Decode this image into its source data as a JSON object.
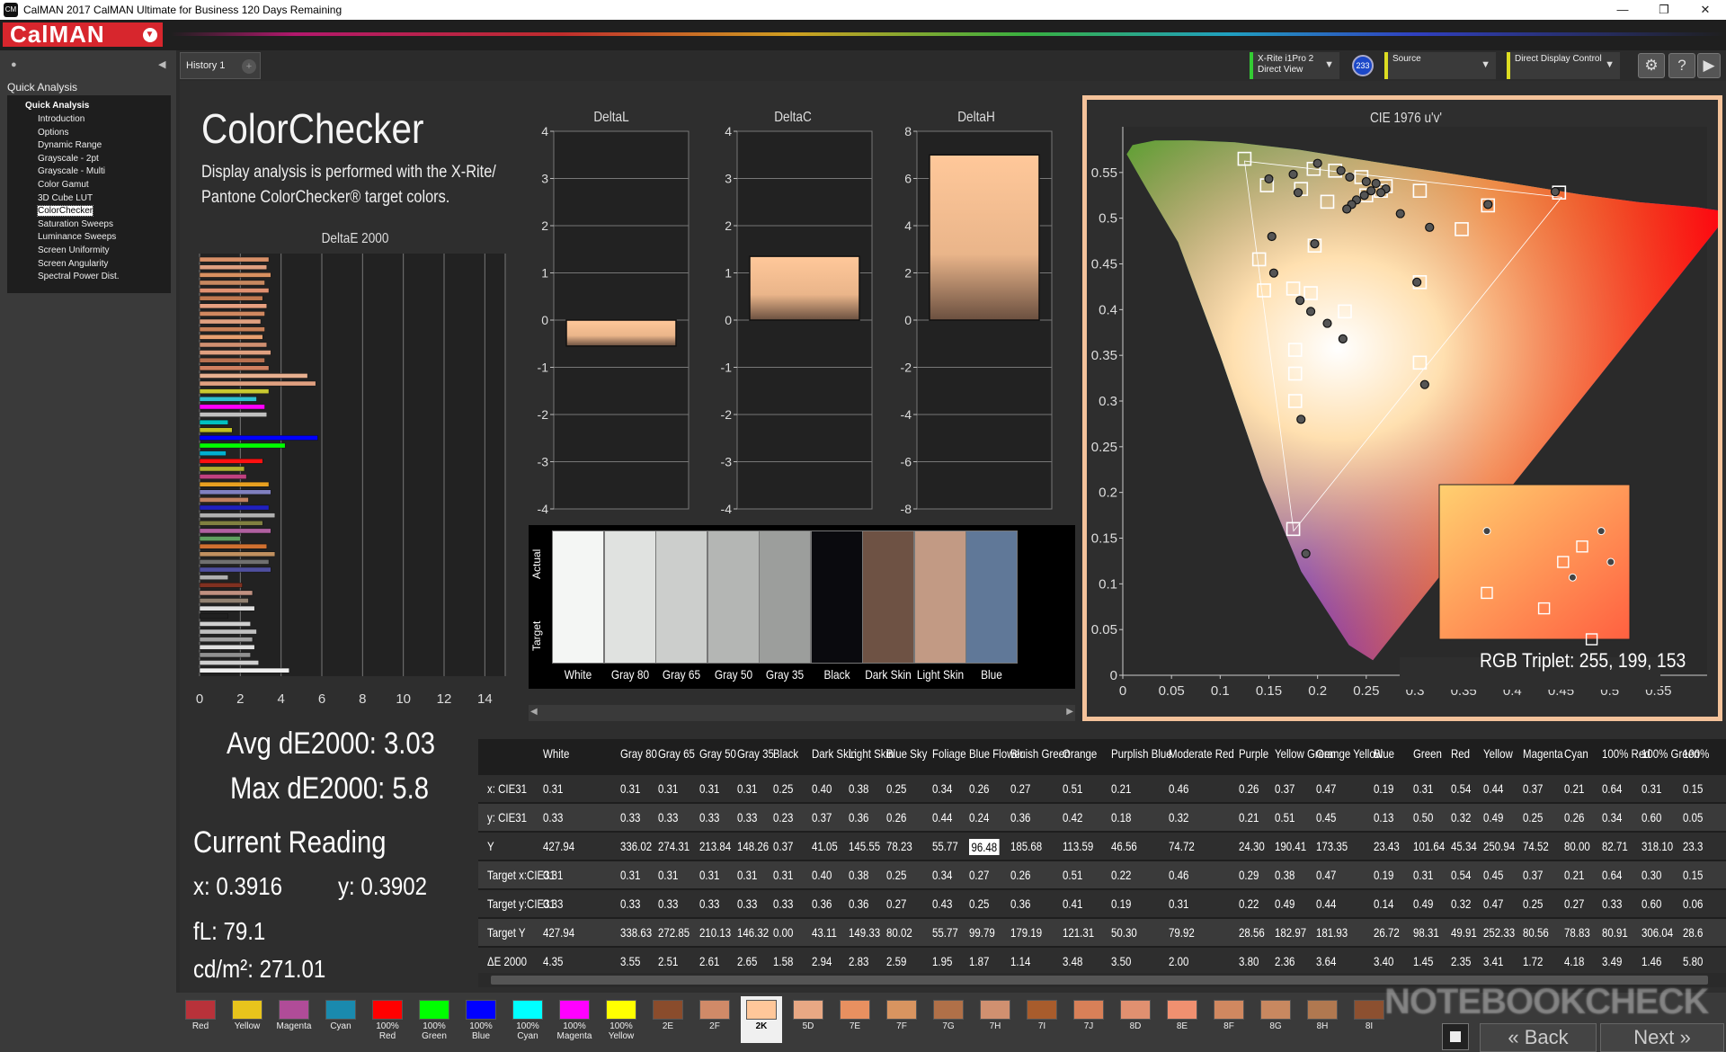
{
  "window": {
    "title": "CalMAN 2017 CalMAN Ultimate for Business 120 Days Remaining",
    "icon_text": "CM"
  },
  "brand": {
    "logo": "CalMAN"
  },
  "sidebar": {
    "heading": "Quick Analysis",
    "root": "Quick Analysis",
    "items": [
      "Introduction",
      "Options",
      "Dynamic Range",
      "Grayscale - 2pt",
      "Grayscale - Multi",
      "Color Gamut",
      "3D Cube LUT",
      "ColorChecker",
      "Saturation Sweeps",
      "Luminance Sweeps",
      "Screen Uniformity",
      "Screen Angularity",
      "Spectral Power Dist."
    ],
    "selected": "ColorChecker"
  },
  "tabs": {
    "history": "History 1"
  },
  "controls": {
    "meter_line1": "X-Rite i1Pro 2",
    "meter_line2": "Direct View",
    "meter_badge": "233",
    "source": "Source",
    "display": "Direct Display Control"
  },
  "page": {
    "title": "ColorChecker",
    "desc_line1": "Display analysis is performed with the X-Rite/",
    "desc_line2": "Pantone ColorChecker® target colors."
  },
  "charts_titles": {
    "de": "DeltaE 2000",
    "dl": "DeltaL",
    "dc": "DeltaC",
    "dh": "DeltaH",
    "cie": "CIE 1976 u'v'"
  },
  "swatch_labels": {
    "actual": "Actual",
    "target": "Target"
  },
  "swatches": [
    {
      "name": "White",
      "color": "#f4f6f4"
    },
    {
      "name": "Gray 80",
      "color": "#e0e2e0"
    },
    {
      "name": "Gray 65",
      "color": "#cccecc"
    },
    {
      "name": "Gray 50",
      "color": "#b4b6b4"
    },
    {
      "name": "Gray 35",
      "color": "#9c9e9c"
    },
    {
      "name": "Black",
      "color": "#0a0a0e"
    },
    {
      "name": "Dark Skin",
      "color": "#6e5244"
    },
    {
      "name": "Light Skin",
      "color": "#c29a84"
    },
    {
      "name": "Blue",
      "color": "#607898"
    }
  ],
  "stats": {
    "avg": "Avg dE2000: 3.03",
    "max": "Max dE2000: 5.8",
    "current_reading": "Current Reading",
    "x": "x: 0.3916",
    "y": "y: 0.3902",
    "fl": "fL: 79.1",
    "cdm2": "cd/m²: 271.01",
    "rgb_triplet": "RGB Triplet: 255, 199, 153"
  },
  "table": {
    "columns": [
      "White",
      "Gray 80",
      "Gray 65",
      "Gray 50",
      "Gray 35",
      "Black",
      "Dark Skin",
      "Light Skin",
      "Blue Sky",
      "Foliage",
      "Blue Flower",
      "Bluish Green",
      "Orange",
      "Purplish Blue",
      "Moderate Red",
      "Purple",
      "Yellow Green",
      "Orange Yellow",
      "Blue",
      "Green",
      "Red",
      "Yellow",
      "Magenta",
      "Cyan",
      "100% Red",
      "100% Green",
      "100%"
    ],
    "rows": [
      {
        "label": "x: CIE31",
        "values": [
          "0.31",
          "0.31",
          "0.31",
          "0.31",
          "0.31",
          "0.25",
          "0.40",
          "0.38",
          "0.25",
          "0.34",
          "0.26",
          "0.27",
          "0.51",
          "0.21",
          "0.46",
          "0.26",
          "0.37",
          "0.47",
          "0.19",
          "0.31",
          "0.54",
          "0.44",
          "0.37",
          "0.21",
          "0.64",
          "0.31",
          "0.15"
        ]
      },
      {
        "label": "y: CIE31",
        "values": [
          "0.33",
          "0.33",
          "0.33",
          "0.33",
          "0.33",
          "0.23",
          "0.37",
          "0.36",
          "0.26",
          "0.44",
          "0.24",
          "0.36",
          "0.42",
          "0.18",
          "0.32",
          "0.21",
          "0.51",
          "0.45",
          "0.13",
          "0.50",
          "0.32",
          "0.49",
          "0.25",
          "0.26",
          "0.34",
          "0.60",
          "0.05"
        ]
      },
      {
        "label": "Y",
        "values": [
          "427.94",
          "336.02",
          "274.31",
          "213.84",
          "148.26",
          "0.37",
          "41.05",
          "145.55",
          "78.23",
          "55.77",
          "96.48",
          "185.68",
          "113.59",
          "46.56",
          "74.72",
          "24.30",
          "190.41",
          "173.35",
          "23.43",
          "101.64",
          "45.34",
          "250.94",
          "74.52",
          "80.00",
          "82.71",
          "318.10",
          "23.3"
        ]
      },
      {
        "label": "Target x:CIE31",
        "values": [
          "0.31",
          "0.31",
          "0.31",
          "0.31",
          "0.31",
          "0.31",
          "0.40",
          "0.38",
          "0.25",
          "0.34",
          "0.27",
          "0.26",
          "0.51",
          "0.22",
          "0.46",
          "0.29",
          "0.38",
          "0.47",
          "0.19",
          "0.31",
          "0.54",
          "0.45",
          "0.37",
          "0.21",
          "0.64",
          "0.30",
          "0.15"
        ]
      },
      {
        "label": "Target y:CIE31",
        "values": [
          "0.33",
          "0.33",
          "0.33",
          "0.33",
          "0.33",
          "0.33",
          "0.36",
          "0.36",
          "0.27",
          "0.43",
          "0.25",
          "0.36",
          "0.41",
          "0.19",
          "0.31",
          "0.22",
          "0.49",
          "0.44",
          "0.14",
          "0.49",
          "0.32",
          "0.47",
          "0.25",
          "0.27",
          "0.33",
          "0.60",
          "0.06"
        ]
      },
      {
        "label": "Target Y",
        "values": [
          "427.94",
          "338.63",
          "272.85",
          "210.13",
          "146.32",
          "0.00",
          "43.11",
          "149.33",
          "80.02",
          "55.77",
          "99.79",
          "179.19",
          "121.31",
          "50.30",
          "79.92",
          "28.56",
          "182.97",
          "181.93",
          "26.72",
          "98.31",
          "49.91",
          "252.33",
          "80.56",
          "78.83",
          "80.91",
          "306.04",
          "28.6"
        ]
      },
      {
        "label": "ΔE 2000",
        "values": [
          "4.35",
          "3.55",
          "2.51",
          "2.61",
          "2.65",
          "1.58",
          "2.94",
          "2.83",
          "2.59",
          "1.95",
          "1.87",
          "1.14",
          "3.48",
          "3.50",
          "2.00",
          "3.80",
          "2.36",
          "3.64",
          "3.40",
          "1.45",
          "2.35",
          "3.41",
          "1.72",
          "4.18",
          "3.49",
          "1.46",
          "5.80"
        ]
      }
    ],
    "highlight": {
      "row": 2,
      "col": 10
    }
  },
  "patches": [
    {
      "label": "Red",
      "color": "#b8323a"
    },
    {
      "label": "Yellow",
      "color": "#e8c41c"
    },
    {
      "label": "Magenta",
      "color": "#b04c98"
    },
    {
      "label": "Cyan",
      "color": "#1a8aae"
    },
    {
      "label": "100% Red",
      "color": "#ff0000"
    },
    {
      "label": "100% Green",
      "color": "#00ff00"
    },
    {
      "label": "100% Blue",
      "color": "#0000ff"
    },
    {
      "label": "100% Cyan",
      "color": "#00ffff"
    },
    {
      "label": "100% Magenta",
      "color": "#ff00ff"
    },
    {
      "label": "100% Yellow",
      "color": "#ffff00"
    },
    {
      "label": "2E",
      "color": "#8a4c2c"
    },
    {
      "label": "2F",
      "color": "#d08a68"
    },
    {
      "label": "2K",
      "color": "#ffc79a"
    },
    {
      "label": "5D",
      "color": "#e8a884"
    },
    {
      "label": "7E",
      "color": "#e89060"
    },
    {
      "label": "7F",
      "color": "#d89460"
    },
    {
      "label": "7G",
      "color": "#b07048"
    },
    {
      "label": "7H",
      "color": "#d09070"
    },
    {
      "label": "7I",
      "color": "#a85c2c"
    },
    {
      "label": "7J",
      "color": "#d88058"
    },
    {
      "label": "8D",
      "color": "#e09070"
    },
    {
      "label": "8E",
      "color": "#f09070"
    },
    {
      "label": "8F",
      "color": "#d08860"
    },
    {
      "label": "8G",
      "color": "#c88860"
    },
    {
      "label": "8H",
      "color": "#b07850"
    },
    {
      "label": "8I",
      "color": "#8c5030"
    }
  ],
  "selected_patch": "2K",
  "nav": {
    "back": "Back",
    "next": "Next"
  },
  "watermark": "NOTEBOOKCHECK",
  "chart_data": [
    {
      "type": "bar",
      "title": "DeltaE 2000",
      "orientation": "horizontal",
      "xlim": [
        0,
        15
      ],
      "xticks": [
        "0",
        "2",
        "4",
        "6",
        "8",
        "10",
        "12",
        "14"
      ],
      "values": [
        3.4,
        3.3,
        3.5,
        3.2,
        3.4,
        3.1,
        3.3,
        3.2,
        3.0,
        3.2,
        3.1,
        3.3,
        3.5,
        3.2,
        3.4,
        5.3,
        5.7,
        3.4,
        2.8,
        3.2,
        3.3,
        1.4,
        1.6,
        5.8,
        4.2,
        1.3,
        3.1,
        2.2,
        2.3,
        3.4,
        3.5,
        2.4,
        3.4,
        3.7,
        3.1,
        3.5,
        2.0,
        3.3,
        3.7,
        3.4,
        3.5,
        1.4,
        2.1,
        2.6,
        2.4,
        2.7,
        1.4,
        2.5,
        2.8,
        2.6,
        2.7,
        2.5,
        2.9,
        4.4
      ],
      "colors": [
        "#d89068",
        "#e0a080",
        "#d89060",
        "#c88860",
        "#e09070",
        "#c07850",
        "#e8a080",
        "#d08860",
        "#e0a080",
        "#c88058",
        "#e8a070",
        "#d09070",
        "#e0a080",
        "#b87050",
        "#d08060",
        "#e8b090",
        "#e0a080",
        "#c8c830",
        "#30c0d0",
        "#ff00ff",
        "#c0c0c0",
        "#00c0c0",
        "#c0c020",
        "#0000ff",
        "#00ff00",
        "#00b0d0",
        "#ff1010",
        "#b0b030",
        "#c04080",
        "#e8a020",
        "#8080c0",
        "#c08060",
        "#2020c0",
        "#b0b0b0",
        "#808040",
        "#b060a0",
        "#60a060",
        "#d07030",
        "#c09060",
        "#707070",
        "#5050a0",
        "#b0b0b0",
        "#803020",
        "#c09080",
        "#908070",
        "#e0e0e0",
        "#202020",
        "#d0d0d0",
        "#c0c0c0",
        "#a0a0a0",
        "#e0e0e0",
        "#909090",
        "#d0d0d0",
        "#f0f0f0"
      ]
    },
    {
      "type": "bar",
      "title": "DeltaL",
      "values": [
        -0.55
      ],
      "ylim": [
        -4,
        4
      ],
      "ticks": [
        "4",
        "3",
        "2",
        "1",
        "0",
        "-1",
        "-2",
        "-3",
        "-4"
      ]
    },
    {
      "type": "bar",
      "title": "DeltaC",
      "values": [
        1.35
      ],
      "ylim": [
        -4,
        4
      ],
      "ticks": [
        "4",
        "3",
        "2",
        "1",
        "0",
        "-1",
        "-2",
        "-3",
        "-4"
      ]
    },
    {
      "type": "bar",
      "title": "DeltaH",
      "values": [
        7.0
      ],
      "ylim": [
        -8,
        8
      ],
      "ticks": [
        "8",
        "6",
        "4",
        "2",
        "0",
        "-2",
        "-4",
        "-6",
        "-8"
      ]
    },
    {
      "type": "scatter",
      "title": "CIE 1976 u'v'",
      "xlim": [
        0,
        0.6
      ],
      "ylim": [
        0,
        0.6
      ],
      "xticks": [
        "0",
        "0.05",
        "0.1",
        "0.15",
        "0.2",
        "0.25",
        "0.3",
        "0.35",
        "0.4",
        "0.45",
        "0.5",
        "0.55"
      ],
      "yticks": [
        "0",
        "0.05",
        "0.1",
        "0.15",
        "0.2",
        "0.25",
        "0.3",
        "0.35",
        "0.4",
        "0.45",
        "0.5",
        "0.55"
      ],
      "targets": [
        [
          0.125,
          0.565
        ],
        [
          0.148,
          0.536
        ],
        [
          0.183,
          0.532
        ],
        [
          0.196,
          0.554
        ],
        [
          0.218,
          0.552
        ],
        [
          0.245,
          0.545
        ],
        [
          0.27,
          0.535
        ],
        [
          0.305,
          0.53
        ],
        [
          0.375,
          0.514
        ],
        [
          0.448,
          0.528
        ],
        [
          0.25,
          0.525
        ],
        [
          0.265,
          0.53
        ],
        [
          0.21,
          0.518
        ],
        [
          0.197,
          0.47
        ],
        [
          0.14,
          0.455
        ],
        [
          0.145,
          0.421
        ],
        [
          0.175,
          0.423
        ],
        [
          0.193,
          0.418
        ],
        [
          0.228,
          0.398
        ],
        [
          0.305,
          0.43
        ],
        [
          0.305,
          0.342
        ],
        [
          0.177,
          0.356
        ],
        [
          0.177,
          0.33
        ],
        [
          0.177,
          0.3
        ],
        [
          0.175,
          0.16
        ],
        [
          0.348,
          0.488
        ]
      ],
      "actuals": [
        [
          0.15,
          0.543
        ],
        [
          0.175,
          0.548
        ],
        [
          0.18,
          0.528
        ],
        [
          0.2,
          0.56
        ],
        [
          0.224,
          0.552
        ],
        [
          0.233,
          0.545
        ],
        [
          0.25,
          0.54
        ],
        [
          0.26,
          0.538
        ],
        [
          0.27,
          0.532
        ],
        [
          0.265,
          0.528
        ],
        [
          0.255,
          0.53
        ],
        [
          0.248,
          0.525
        ],
        [
          0.24,
          0.52
        ],
        [
          0.235,
          0.515
        ],
        [
          0.23,
          0.51
        ],
        [
          0.285,
          0.505
        ],
        [
          0.315,
          0.49
        ],
        [
          0.375,
          0.515
        ],
        [
          0.444,
          0.529
        ],
        [
          0.153,
          0.48
        ],
        [
          0.197,
          0.472
        ],
        [
          0.155,
          0.44
        ],
        [
          0.193,
          0.398
        ],
        [
          0.182,
          0.41
        ],
        [
          0.21,
          0.385
        ],
        [
          0.226,
          0.368
        ],
        [
          0.302,
          0.43
        ],
        [
          0.31,
          0.318
        ],
        [
          0.183,
          0.28
        ],
        [
          0.188,
          0.133
        ]
      ],
      "inset_targets": [
        [
          0.28,
          0.5
        ],
        [
          0.31,
          0.45
        ],
        [
          0.26,
          0.47
        ],
        [
          0.2,
          0.48
        ],
        [
          0.3,
          0.51
        ]
      ],
      "inset_actuals": [
        [
          0.2,
          0.52
        ],
        [
          0.29,
          0.49
        ],
        [
          0.32,
          0.52
        ],
        [
          0.33,
          0.5
        ]
      ]
    }
  ]
}
